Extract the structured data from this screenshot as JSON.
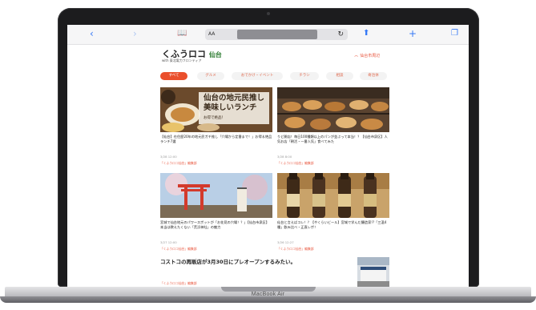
{
  "device": {
    "label": "MacBook Air"
  },
  "browser": {
    "address_text_size": "AA",
    "icons": [
      "back-icon",
      "forward-icon",
      "book-icon",
      "reload-icon",
      "share-icon",
      "new-tab-icon",
      "tabs-icon"
    ]
  },
  "site": {
    "logo_text": "くふうロコ",
    "logo_city": "仙台",
    "tagline": "with 東北電力フロンティア",
    "area_button": "仙台市周辺",
    "accent": "#ea4f2c"
  },
  "tabs": [
    "すべて",
    "グルメ",
    "おでかけ・イベント",
    "チラシ",
    "相談",
    "奇治体"
  ],
  "cards": [
    {
      "thumb_caption": "仙台の地元民推し美味しいランチ",
      "thumb_sub": "お得で絶品！",
      "title": "【仙台】在住歴20年の地元民ガチ推し「穴場から定番まで！」お得＆絶品ランチ7選",
      "date": "3/28 12:00",
      "author": "「くふうロコ仙台」編集部"
    },
    {
      "thumb_caption": "",
      "thumb_sub": "",
      "title": "りど開店！毎日100種類以上のパンが並ぶって本当！？【仙台市泉区】人気お店「朝活・一番人気」食べてみた",
      "date": "3/28 8:00",
      "author": "「くふうロコ仙台」編集部"
    },
    {
      "thumb_caption": "",
      "thumb_sub": "",
      "title": "宮城で仙台地元のパワースポットが「お花見の穴場！？」【仙台市泉区】本当は教えたくない「荒浜神社」の魅力",
      "date": "3/27 12:00",
      "author": "「くふうロコ仙台」編集部"
    },
    {
      "thumb_caption": "",
      "thumb_sub": "",
      "title": "仙台と言えばコレ！？【やくらいビール】宮城で学んだ醸造家!?「三温4種」飲み比べ・正直レポ！",
      "date": "3/26 12:27",
      "author": "「くふうロコ仙台」編集部"
    }
  ],
  "headline": {
    "title": "コストコの再販店が3月30日にプレオープンするみたい。",
    "meta": "「くふうロコ仙台」編集部"
  }
}
